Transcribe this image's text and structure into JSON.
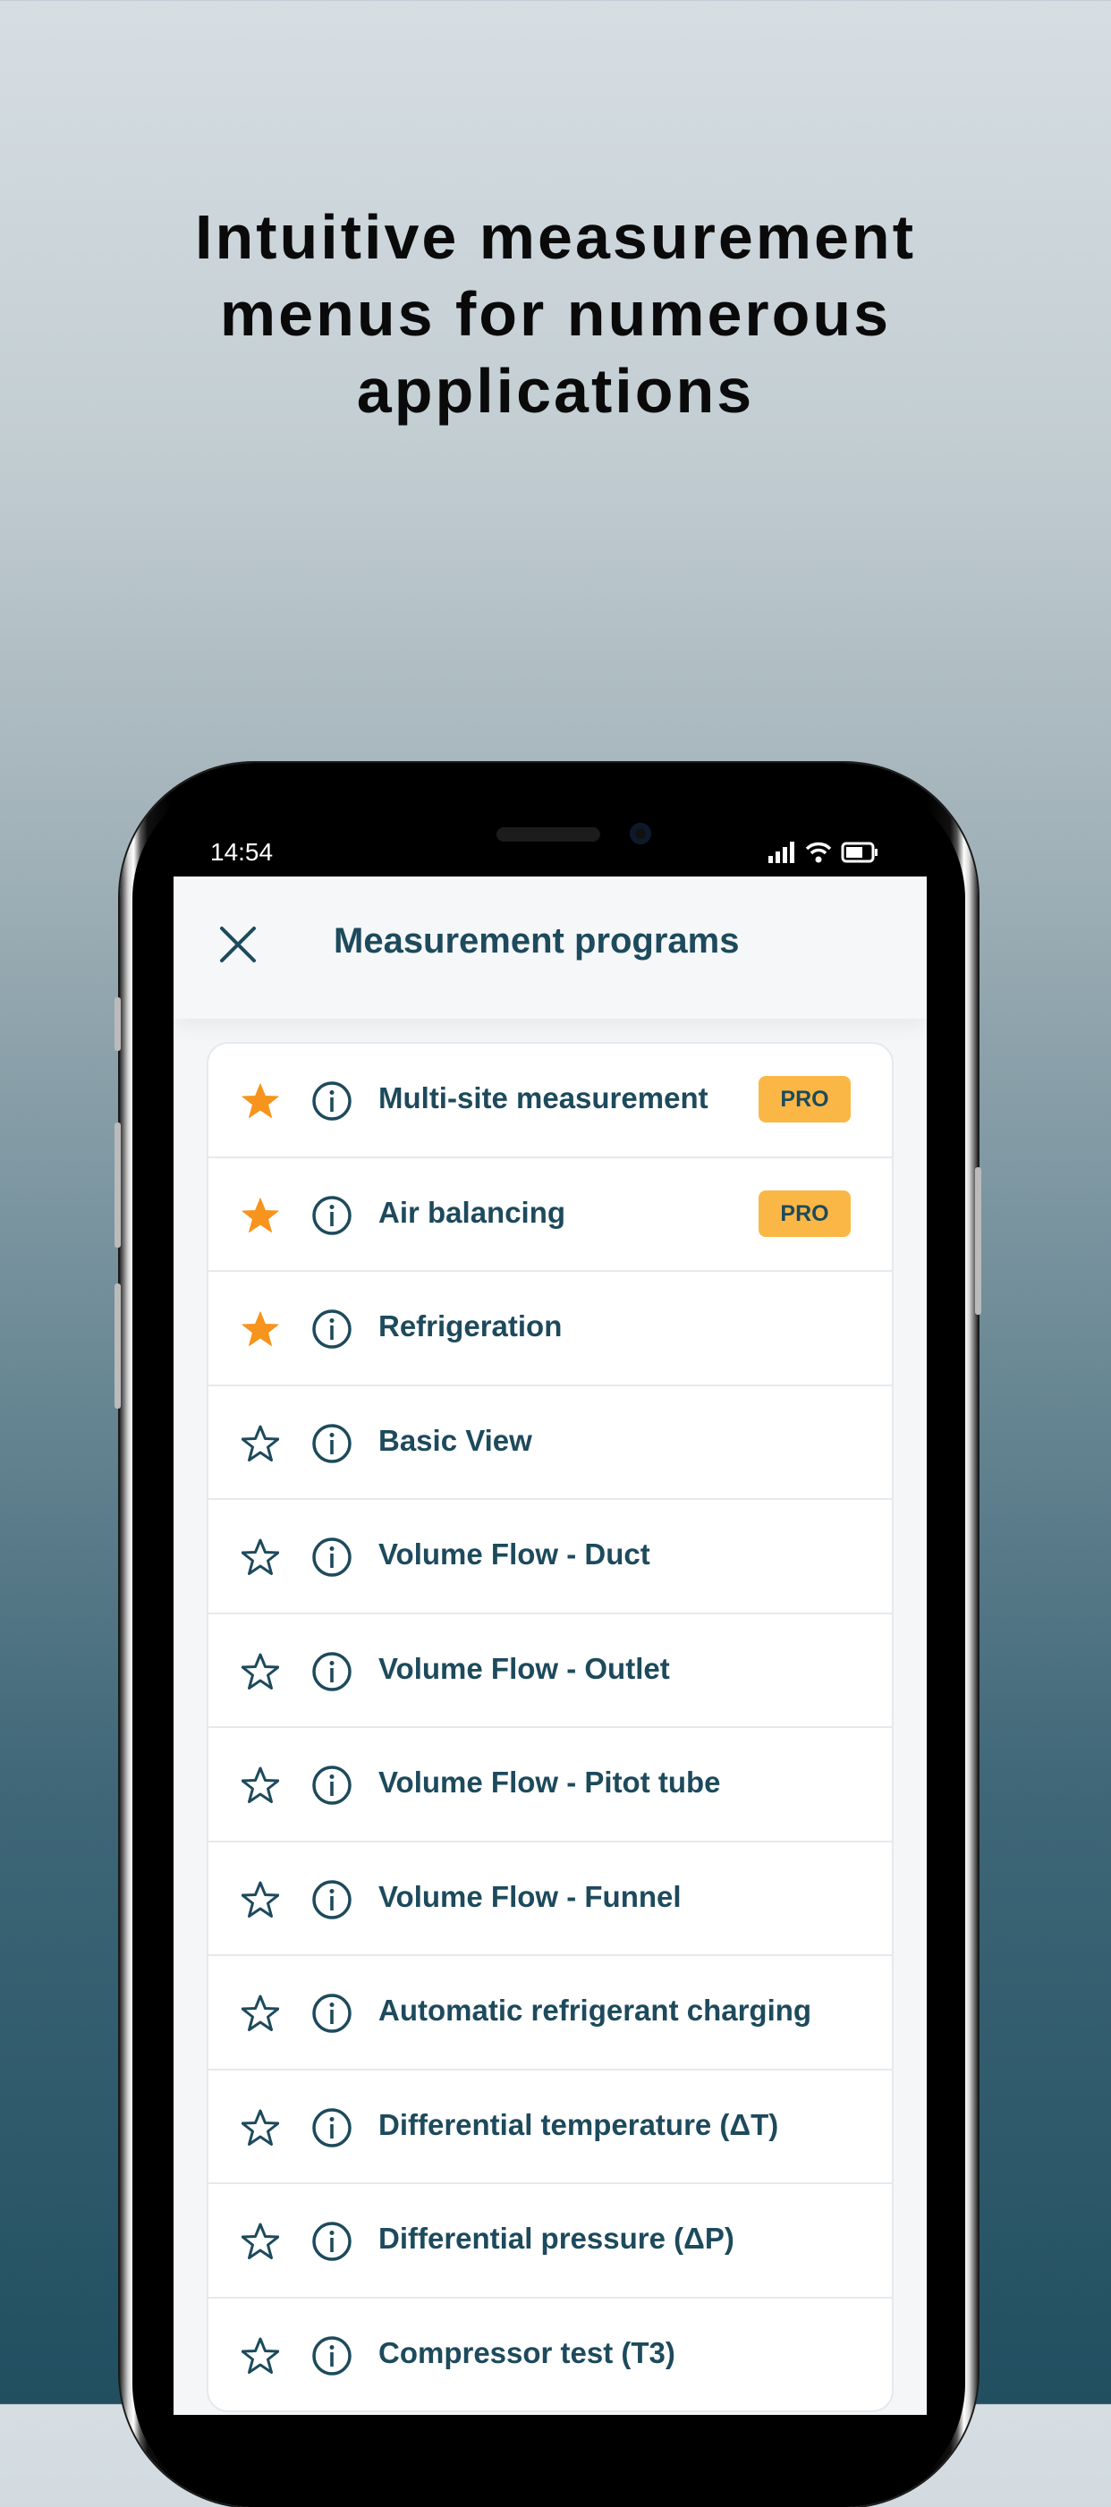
{
  "headline": {
    "lines": [
      "Intuitive measurement",
      "menus for numerous",
      "applications"
    ]
  },
  "status_bar": {
    "time": "14:54",
    "icons": [
      "signal-icon",
      "wifi-icon",
      "battery-icon"
    ]
  },
  "header": {
    "title": "Measurement programs",
    "close_icon": "close-icon"
  },
  "colors": {
    "accent_star": "#f7941d",
    "pro_badge": "#fbb746",
    "text": "#1d4a5c"
  },
  "programs": [
    {
      "label": "Multi-site measurement",
      "favorite": true,
      "badge": "PRO"
    },
    {
      "label": "Air balancing",
      "favorite": true,
      "badge": "PRO"
    },
    {
      "label": "Refrigeration",
      "favorite": true,
      "badge": null
    },
    {
      "label": "Basic View",
      "favorite": false,
      "badge": null
    },
    {
      "label": "Volume Flow - Duct",
      "favorite": false,
      "badge": null
    },
    {
      "label": "Volume Flow - Outlet",
      "favorite": false,
      "badge": null
    },
    {
      "label": "Volume Flow - Pitot tube",
      "favorite": false,
      "badge": null
    },
    {
      "label": "Volume Flow - Funnel",
      "favorite": false,
      "badge": null
    },
    {
      "label": "Automatic refrigerant charging",
      "favorite": false,
      "badge": null
    },
    {
      "label": "Differential temperature (ΔT)",
      "favorite": false,
      "badge": null
    },
    {
      "label": "Differential pressure (ΔP)",
      "favorite": false,
      "badge": null
    },
    {
      "label": "Compressor test (T3)",
      "favorite": false,
      "badge": null
    }
  ]
}
